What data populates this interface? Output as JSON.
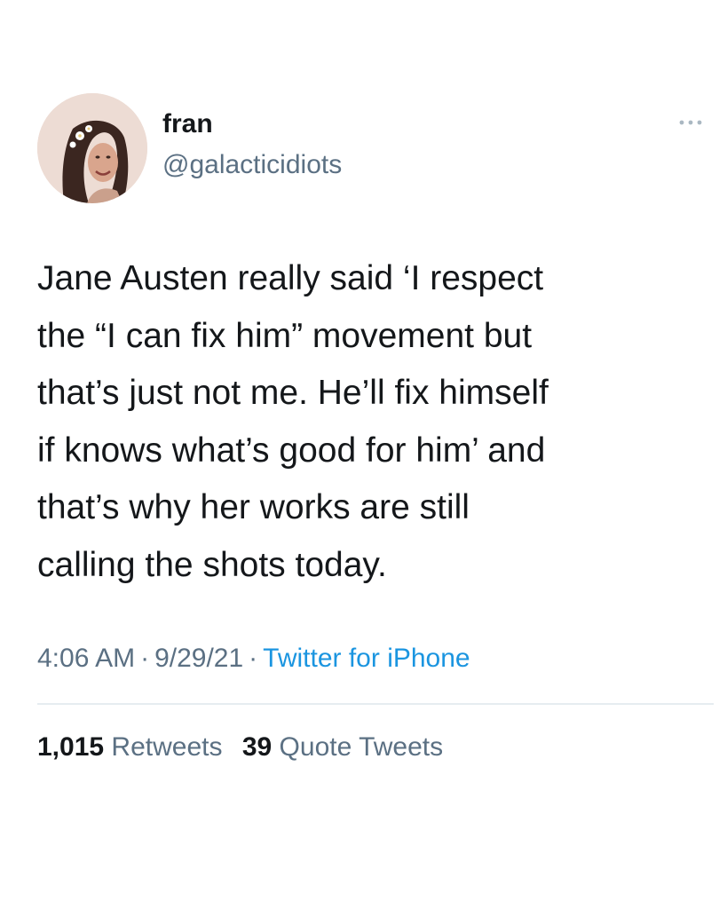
{
  "tweet": {
    "author": {
      "name": "fran",
      "handle": "@galacticidiots",
      "avatar": "profile-photo"
    },
    "more_icon": "more-options-icon",
    "text_lines": [
      "Jane Austen really said ‘I respect",
      "the “I can fix him” movement but",
      "that’s just not me. He’ll fix himself",
      "if knows what’s good for him’ and",
      "that’s why her works are still",
      "calling the shots today."
    ],
    "meta": {
      "time": "4:06 AM",
      "separator": "·",
      "date": "9/29/21",
      "source": "Twitter for iPhone"
    },
    "stats": {
      "retweets_count": "1,015",
      "retweets_label": "Retweets",
      "quotes_count": "39",
      "quotes_label": "Quote Tweets"
    }
  },
  "colors": {
    "text_primary": "#14171a",
    "text_secondary": "#5b7083",
    "link": "#1b95e0",
    "divider": "#e6ecf0"
  }
}
